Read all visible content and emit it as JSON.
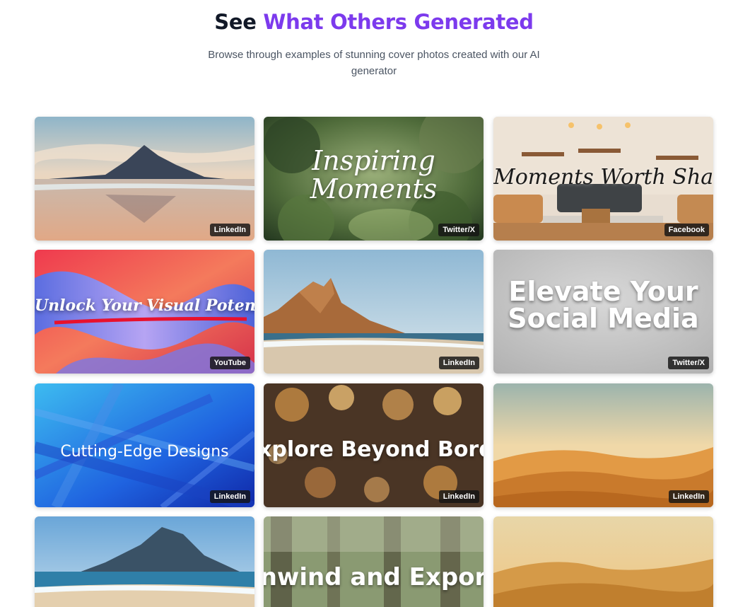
{
  "header": {
    "title_plain": "See",
    "title_accent": "What Others Generated",
    "subtitle": "Browse through examples of stunning cover photos created with our AI generator"
  },
  "colors": {
    "accent": "#7c3aed",
    "badge_bg": "#1f1f1f"
  },
  "cards": [
    {
      "scene": "mountain-beach-sunset",
      "text": "",
      "platform": "LinkedIn"
    },
    {
      "scene": "green-foliage",
      "text": "Inspiring Moments",
      "platform": "Twitter/X"
    },
    {
      "scene": "cozy-living-room",
      "text": "Moments Worth Sharing",
      "platform": "Facebook"
    },
    {
      "scene": "abstract-swirl",
      "text": "Unlock Your Visual Potential",
      "platform": "YouTube"
    },
    {
      "scene": "rocky-mountain-coast",
      "text": "",
      "platform": "LinkedIn"
    },
    {
      "scene": "grey-gradient",
      "text": "Elevate Your Social Media",
      "platform": "Twitter/X"
    },
    {
      "scene": "blue-geometric",
      "text": "Cutting-Edge Designs",
      "platform": "LinkedIn"
    },
    {
      "scene": "bokeh-lights",
      "text": "xplore Beyond Borde",
      "platform": "LinkedIn"
    },
    {
      "scene": "desert-dunes",
      "text": "",
      "platform": "LinkedIn"
    },
    {
      "scene": "mountain-sea-blue",
      "text": "",
      "platform": ""
    },
    {
      "scene": "forest-trees",
      "text": "nwind and Expor",
      "platform": ""
    },
    {
      "scene": "golden-hills",
      "text": "",
      "platform": ""
    }
  ]
}
